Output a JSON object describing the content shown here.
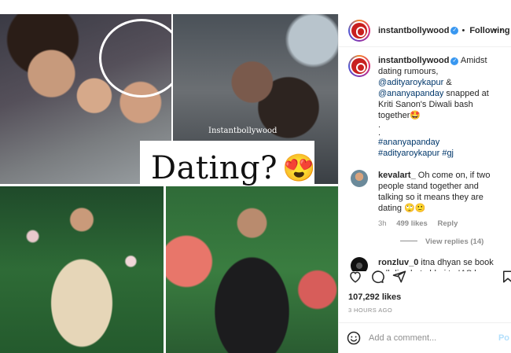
{
  "collage": {
    "watermark": "Instantbollywood",
    "dating_text": "Dating?",
    "dating_emoji": "😍"
  },
  "header": {
    "username": "instantbollywood",
    "verified_mark": "✓",
    "dot": "•",
    "follow_label": "Following",
    "more_label": "···"
  },
  "caption": {
    "username": "instantbollywood",
    "text_before": " Amidst dating rumours, ",
    "mention1": "@adityaroykapur",
    "text_mid": " & ",
    "mention2": "@ananyapanday",
    "text_after": " snapped at Kriti Sanon's Diwali bash together🤩",
    "dot1": ".",
    "dot2": ".",
    "hashtags": "#ananyapanday #adityaroykapur #gj"
  },
  "comments": [
    {
      "username": "kevalart_",
      "text": " Oh come on, if two people stand together and talking so it means they are dating 🙄🙂",
      "age": "3h",
      "likes": "499 likes",
      "reply_label": "Reply"
    },
    {
      "username": "ronzluv_0",
      "text": " itna dhyan se book pdh liye hote bhai to IAS bn gye hote 🤣"
    }
  ],
  "view_replies": "View replies (14)",
  "likes_count": "107,292 likes",
  "time_ago": "3 HOURS AGO",
  "add_comment": {
    "placeholder": "Add a comment...",
    "post_label": "Po"
  },
  "icons": [
    "heart-icon",
    "comment-icon",
    "share-icon",
    "bookmark-icon",
    "emoji-icon"
  ],
  "colors": {
    "link": "#00376b",
    "verified": "#3897f0",
    "muted": "#8e8e8e"
  }
}
